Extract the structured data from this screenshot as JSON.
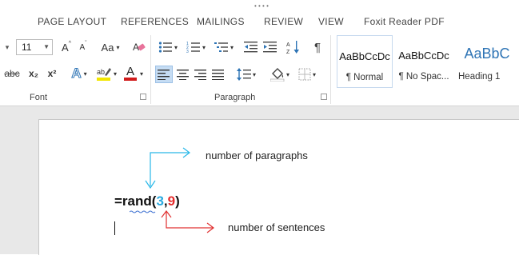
{
  "tabs": [
    "PAGE LAYOUT",
    "REFERENCES",
    "MAILINGS",
    "REVIEW",
    "VIEW",
    "Foxit Reader PDF"
  ],
  "font": {
    "size_value": "11",
    "grow_label": "A",
    "shrink_label": "A",
    "case_label": "Aa",
    "strike_label": "abc",
    "subscript_label": "x₂",
    "superscript_label": "x²",
    "text_effects_label": "A",
    "font_color_label": "A",
    "group_label": "Font"
  },
  "paragraph": {
    "show_marks_label": "¶",
    "group_label": "Paragraph"
  },
  "styles": [
    {
      "preview": "AaBbCcDc",
      "name": "¶ Normal",
      "selected": true
    },
    {
      "preview": "AaBbCcDc",
      "name": "¶ No Spac...",
      "selected": false
    },
    {
      "preview": "AaBbC",
      "name": "Heading 1",
      "selected": false
    }
  ],
  "colors": {
    "highlight": "#f2e600",
    "font_color": "#d11b1b",
    "cyan_arrow": "#29b8e8",
    "red_arrow": "#e03030",
    "heading_blue": "#2e74b5"
  },
  "document": {
    "formula_prefix": "=rand(",
    "formula_arg1": "3",
    "formula_sep": ",",
    "formula_arg2": "9",
    "formula_suffix": ")"
  },
  "annotations": {
    "paragraphs": "number of paragraphs",
    "sentences": "number of sentences"
  }
}
